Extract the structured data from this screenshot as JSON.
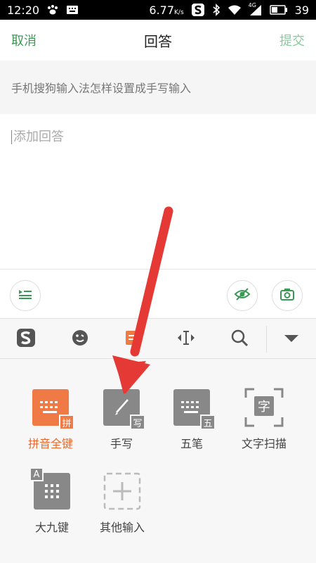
{
  "status_bar": {
    "time": "12:20",
    "speed": "6.77",
    "speed_unit": "K/s",
    "network": "4G",
    "battery": "39"
  },
  "header": {
    "cancel_label": "取消",
    "title": "回答",
    "submit_label": "提交"
  },
  "question": {
    "text": "手机搜狗输入法怎样设置成手写输入"
  },
  "answer": {
    "placeholder": "添加回答"
  },
  "keyboard_modes": [
    {
      "label": "拼音全键",
      "badge": "拼",
      "active": true
    },
    {
      "label": "手写",
      "badge": "写",
      "active": false
    },
    {
      "label": "五笔",
      "badge": "五",
      "active": false
    },
    {
      "label": "文字扫描",
      "badge": "字",
      "active": false
    },
    {
      "label": "大九键",
      "badge": "A",
      "active": false
    },
    {
      "label": "其他输入",
      "badge": "",
      "active": false
    }
  ],
  "colors": {
    "accent_green": "#3a9a55",
    "submit_disabled": "#8cc9a0",
    "keyboard_orange": "#f07a46",
    "arrow_red": "#e53935"
  }
}
